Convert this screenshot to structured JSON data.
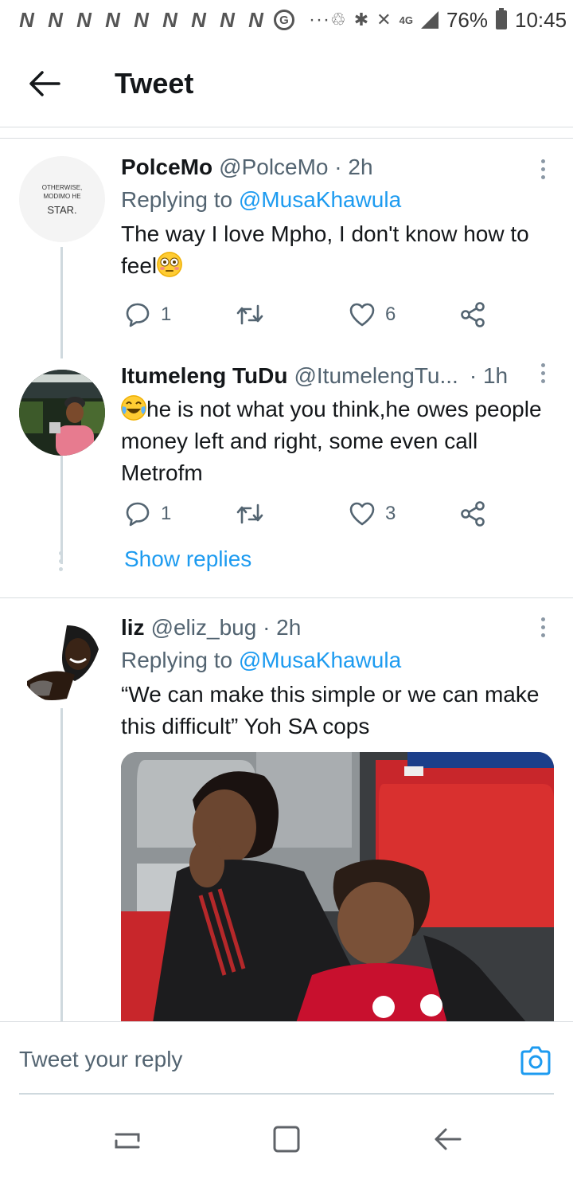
{
  "status_bar": {
    "notif_letters": [
      "N",
      "N",
      "N",
      "N",
      "N",
      "N",
      "N",
      "N",
      "N"
    ],
    "g_icon": "G",
    "dots": "···",
    "network": "4G",
    "battery_pct": "76%",
    "time": "10:45"
  },
  "header": {
    "title": "Tweet",
    "back_icon": "arrow-left-icon"
  },
  "tweets": [
    {
      "name": "PolceMo",
      "handle": "@PolceMo · 2h",
      "replying_prefix": "Replying to ",
      "replying_to": "@MusaKhawula",
      "text_before_emoji": "The way I love Mpho, I don't know how to feel",
      "emoji": "flushed-face-emoji",
      "avatar_text_small": "OTHERWISE, MODIMO HE",
      "avatar_text_large": "STAR.",
      "reply_count": "1",
      "like_count": "6"
    },
    {
      "name": "Itumeleng TuDu",
      "handle": "@ItumelengTu...",
      "time": "· 1h",
      "emoji": "tears-of-joy-emoji",
      "text": "he is not what you think,he owes people money left and right, some even call Metrofm",
      "reply_count": "1",
      "like_count": "3",
      "show_replies": "Show replies"
    },
    {
      "name": "liz",
      "handle": "@eliz_bug · 2h",
      "replying_prefix": "Replying to ",
      "replying_to": "@MusaKhawula",
      "text": "“We can make this simple or we can make this difficult” Yoh SA cops",
      "media": "photo-two-footballers-laughing-in-stadium-seats"
    }
  ],
  "reply_bar": {
    "placeholder": "Tweet your reply",
    "camera_icon": "camera-icon"
  },
  "nav_bar": {
    "recents_icon": "recent-apps-icon",
    "home_icon": "home-icon",
    "back_icon": "back-icon"
  },
  "colors": {
    "accent": "#1d9bf0",
    "secondary_text": "#536471",
    "divider": "#d9dde0"
  }
}
